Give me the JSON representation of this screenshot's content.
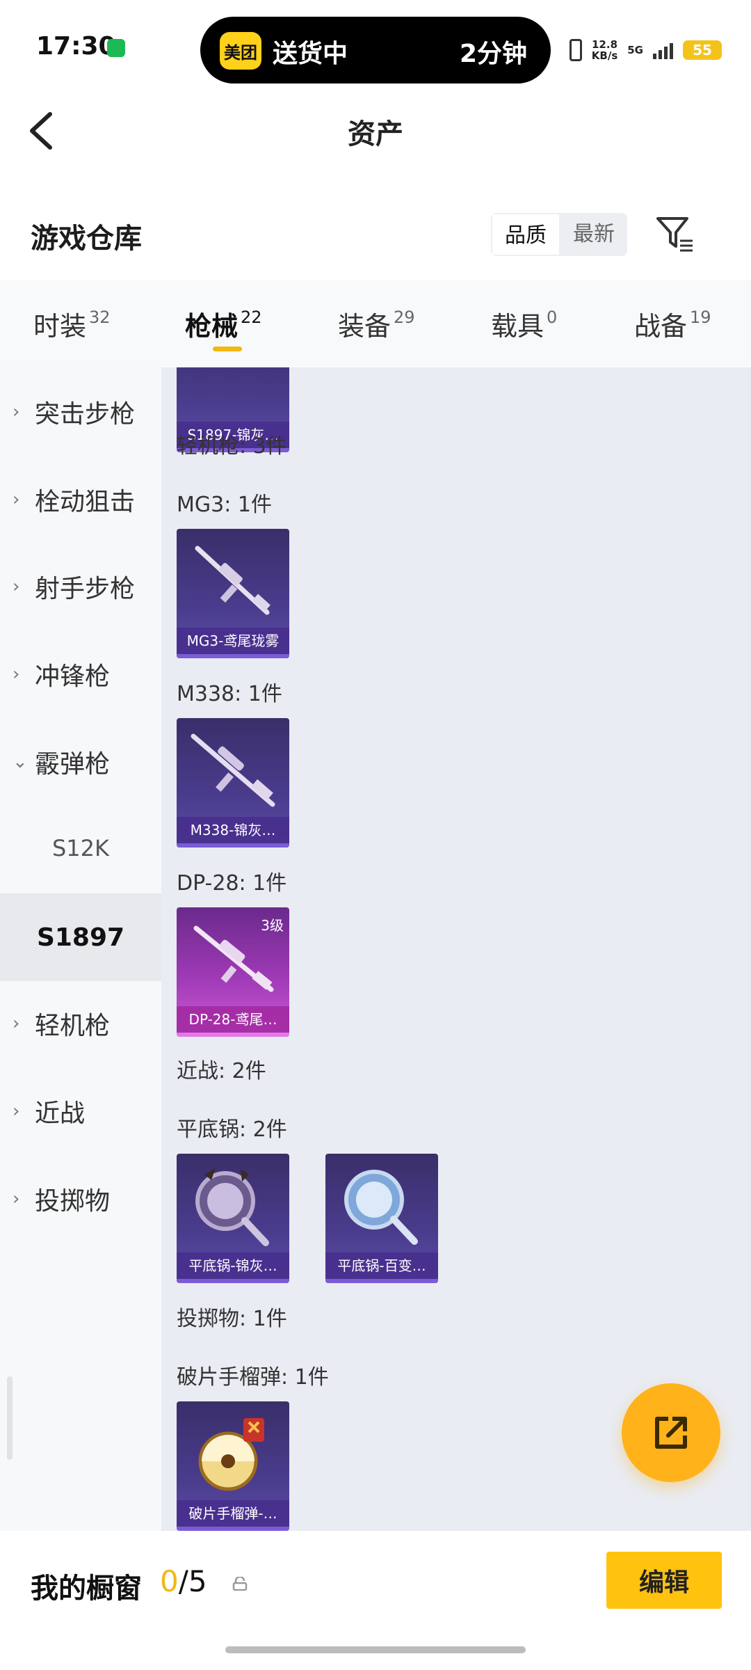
{
  "status_bar": {
    "time": "17:30",
    "island_app": "美团",
    "island_text": "送货中",
    "island_eta": "2分钟",
    "speed_value": "12.8",
    "speed_unit": "KB/s",
    "network": "5G",
    "battery": "55"
  },
  "header": {
    "title": "资产"
  },
  "section": {
    "title": "游戏仓库",
    "sort_options": [
      "品质",
      "最新"
    ],
    "selected_sort": "品质"
  },
  "tabs": [
    {
      "label": "时装",
      "count": "32"
    },
    {
      "label": "枪械",
      "count": "22",
      "active": true
    },
    {
      "label": "装备",
      "count": "29"
    },
    {
      "label": "载具",
      "count": "0"
    },
    {
      "label": "战备",
      "count": "19"
    }
  ],
  "sidebar": [
    {
      "label": "突击步枪",
      "type": "group"
    },
    {
      "label": "栓动狙击",
      "type": "group"
    },
    {
      "label": "射手步枪",
      "type": "group"
    },
    {
      "label": "冲锋枪",
      "type": "group"
    },
    {
      "label": "霰弹枪",
      "type": "group-expanded"
    },
    {
      "label": "S12K",
      "type": "sub"
    },
    {
      "label": "S1897",
      "type": "sub-selected"
    },
    {
      "label": "轻机枪",
      "type": "group"
    },
    {
      "label": "近战",
      "type": "group"
    },
    {
      "label": "投掷物",
      "type": "group"
    }
  ],
  "content": {
    "cards": [
      {
        "name": "S1897-锦灰…"
      },
      {
        "name": "MG3-鸢尾珑雾"
      },
      {
        "name": "M338-锦灰…"
      },
      {
        "name": "DP-28-鸢尾…",
        "level": "3级"
      },
      {
        "name": "平底锅-锦灰…"
      },
      {
        "name": "平底锅-百变…"
      },
      {
        "name": "破片手榴弹-…"
      }
    ],
    "labels": [
      "轻机枪: 3件",
      "MG3: 1件",
      "M338: 1件",
      "DP-28: 1件",
      "近战: 2件",
      "平底锅: 2件",
      "投掷物: 1件",
      "破片手榴弹: 1件"
    ]
  },
  "bottom": {
    "label": "我的橱窗",
    "current": "0",
    "total": "/5",
    "edit": "编辑"
  },
  "colors": {
    "accent": "#f3b712",
    "fab": "#ffb21a",
    "edit_button": "#ffc20e"
  }
}
